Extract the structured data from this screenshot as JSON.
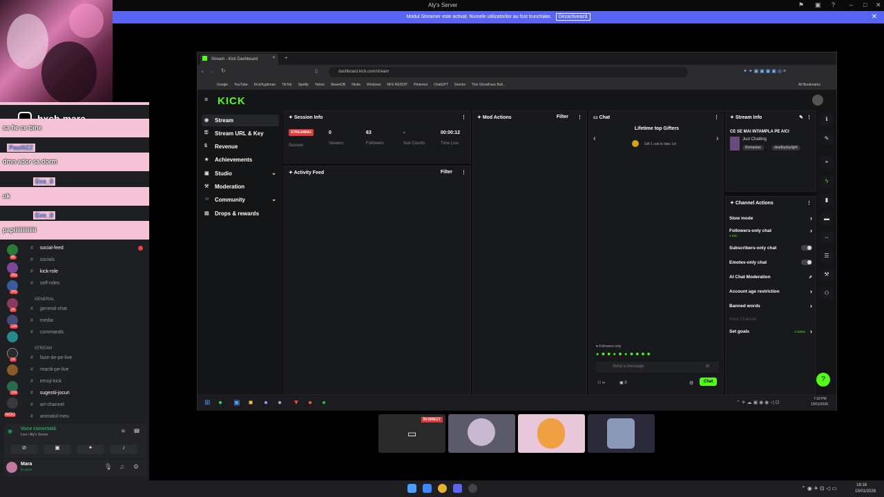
{
  "window_title": "Aly's Server",
  "streamer_banner": {
    "text": "Modul Streamer este activat. Numele utilizatorilor au fost trunchiate.",
    "button": "Dezactivează"
  },
  "overlay": {
    "handle": "hxsh.mara"
  },
  "chat_overlay": [
    {
      "user": "Paul0ZZ",
      "text": "dmn ador sa dorm"
    },
    {
      "user": "Eve_8",
      "text": "ok"
    },
    {
      "user": "Eve_8",
      "text": "papiiiiiiiiiiiii"
    }
  ],
  "chat_overlay_first": "sa fie ce bine",
  "discord": {
    "channels": [
      {
        "name": "social-feed",
        "bold": true
      },
      {
        "name": "socials",
        "bold": false
      },
      {
        "name": "kick-role",
        "bold": true
      },
      {
        "name": "self-roles",
        "bold": false
      }
    ],
    "cat_general": "GENERAL",
    "general_channels": [
      "general-chat",
      "media",
      "commands"
    ],
    "cat_stream": "STREAM",
    "stream_channels": [
      {
        "name": "faze-de-pe-live",
        "bold": false
      },
      {
        "name": "reactii-pe-live",
        "bold": false
      },
      {
        "name": "emoji-kick",
        "bold": false
      },
      {
        "name": "sugestii-jocuri",
        "bold": true
      },
      {
        "name": "art-channel",
        "bold": false
      },
      {
        "name": "animalul-meu",
        "bold": false
      }
    ],
    "server_badges": [
      "80",
      "253",
      "241",
      "24",
      "124",
      "24",
      "124",
      "NOU"
    ],
    "voice_status": "Voce conectată",
    "voice_channel": "Live / Aly's Server",
    "user_name": "Mara",
    "user_status": "În voce"
  },
  "browser": {
    "tab_title": "Stream - Kick Dashboard",
    "url": "dashboard.kick.com/stream",
    "bookmarks": [
      "Google",
      "YouTube",
      "Kick/hyghman",
      "TikTok",
      "Spotify",
      "Yahoo",
      "SteamDB",
      "Ninite",
      "Windows",
      "NFS REDDIT",
      "Pinterest",
      "ChatGPT",
      "Gemini",
      "This GhostFace Bull..."
    ],
    "all_bookmarks": "All Bookmarks"
  },
  "kick": {
    "logo": "KICK",
    "nav": [
      "Stream",
      "Stream URL & Key",
      "Revenue",
      "Achievements",
      "Studio",
      "Moderation",
      "Community",
      "Drops & rewards"
    ],
    "session_info": {
      "title": "Session Info",
      "status": "STREAMING",
      "status_label": "Session",
      "viewers": "0",
      "viewers_label": "Viewers",
      "followers": "63",
      "followers_label": "Followers",
      "subs": "-",
      "subs_label": "Sub Counts",
      "time": "00:00:12",
      "time_label": "Time Live"
    },
    "activity_feed": {
      "title": "Activity Feed",
      "filter": "Filter"
    },
    "mod_actions": {
      "title": "Mod Actions",
      "filter": "Filter"
    },
    "chat": {
      "title": "Chat",
      "top_gifters": "Lifetime top Gifters",
      "gift_text": "Gift 1 sub to take 1st",
      "followers_only": "Followers only",
      "placeholder": "Send a message",
      "send": "Chat",
      "count": "0"
    },
    "stream_info": {
      "title": "Stream Info",
      "stream_title": "CE SE MAI INTAMPLA PE AICI",
      "category": "Just Chatting",
      "tags": [
        "Romanian",
        "deadbydaylight"
      ]
    },
    "channel_actions": {
      "title": "Channel Actions",
      "items": [
        {
          "label": "Slow mode",
          "kind": "arrow"
        },
        {
          "label": "Followers-only chat",
          "sub": "1 min",
          "kind": "arrow"
        },
        {
          "label": "Subscribers-only chat",
          "kind": "toggle"
        },
        {
          "label": "Emotes-only chat",
          "kind": "toggle"
        },
        {
          "label": "AI Chat Moderation",
          "kind": "ext"
        },
        {
          "label": "Account age restriction",
          "kind": "arrow"
        },
        {
          "label": "Banned words",
          "kind": "arrow"
        },
        {
          "label": "Host Channel",
          "kind": "none"
        },
        {
          "label": "Set goals",
          "sub": "2 active",
          "kind": "arrow"
        }
      ]
    },
    "clock": {
      "time": "7:18 PM",
      "date": "15/01/2026"
    }
  },
  "thumb_live": "ÎN DIRECT",
  "taskbar": {
    "time": "18:18",
    "date": "15/01/2026"
  },
  "colors": {
    "kick_green": "#53fc18",
    "discord_blurple": "#5865f2",
    "overlay_pink": "#f4c3d6"
  }
}
